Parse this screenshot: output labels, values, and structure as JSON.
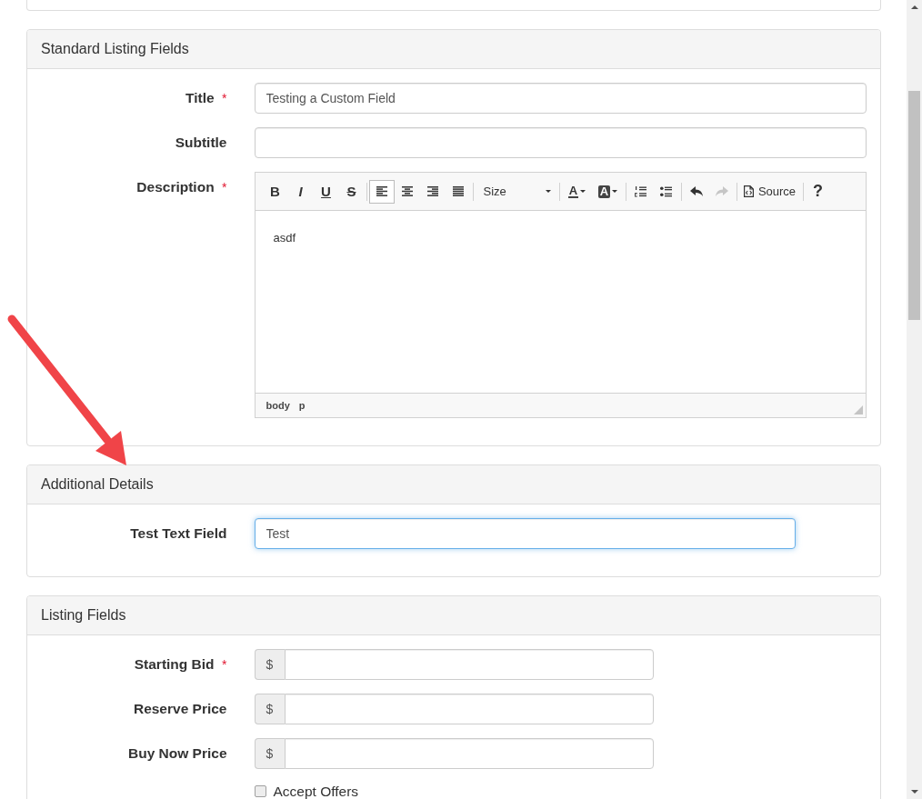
{
  "required_mark": "*",
  "panels": [
    {
      "title": "Standard Listing Fields",
      "fields": [
        {
          "kind": "text",
          "label": "Title",
          "required": true,
          "focused": false,
          "value": "Testing a Custom Field"
        },
        {
          "kind": "text",
          "label": "Subtitle",
          "required": false,
          "focused": false
        },
        {
          "kind": "editor",
          "label": "Description",
          "required": true,
          "toolbar": [
            [
              {
                "kind": "bold",
                "label": "B",
                "selected": false,
                "disabled": false
              },
              {
                "kind": "italic",
                "label": "I",
                "selected": false,
                "disabled": false
              },
              {
                "kind": "underline",
                "label": "U",
                "selected": false,
                "disabled": false
              },
              {
                "kind": "strike",
                "label": "S",
                "selected": false,
                "disabled": false
              }
            ],
            [
              {
                "kind": "alignleft",
                "selected": true,
                "disabled": false
              },
              {
                "kind": "aligncenter",
                "selected": false,
                "disabled": false
              },
              {
                "kind": "alignright",
                "selected": false,
                "disabled": false
              },
              {
                "kind": "justify",
                "selected": false,
                "disabled": false
              }
            ],
            [
              {
                "kind": "size",
                "label": "Size",
                "selected": false,
                "disabled": false
              }
            ],
            [
              {
                "kind": "textcolor",
                "label": "A",
                "selected": false,
                "disabled": false
              },
              {
                "kind": "bgcolor",
                "label": "A",
                "selected": false,
                "disabled": false
              }
            ],
            [
              {
                "kind": "numbered",
                "selected": false,
                "disabled": false
              },
              {
                "kind": "bulleted",
                "selected": false,
                "disabled": false
              }
            ],
            [
              {
                "kind": "undo",
                "selected": false,
                "disabled": false
              },
              {
                "kind": "redo",
                "selected": false,
                "disabled": true
              }
            ],
            [
              {
                "kind": "source",
                "label": "Source",
                "selected": false,
                "disabled": false
              }
            ],
            [
              {
                "kind": "help",
                "label": "?",
                "selected": false,
                "disabled": false
              }
            ]
          ],
          "content": "asdf",
          "element_path": [
            "body",
            "p"
          ]
        }
      ]
    },
    {
      "title": "Additional Details",
      "fields": [
        {
          "kind": "custom",
          "label": "Test Text Field",
          "required": false,
          "focused": true,
          "value": "Test"
        }
      ]
    },
    {
      "title": "Listing Fields",
      "fields": [
        {
          "kind": "money",
          "label": "Starting Bid",
          "required": true,
          "focused": false,
          "prefix": "$"
        },
        {
          "kind": "money",
          "label": "Reserve Price",
          "required": false,
          "focused": false,
          "prefix": "$"
        },
        {
          "kind": "money",
          "label": "Buy Now Price",
          "required": false,
          "focused": false,
          "prefix": "$"
        },
        {
          "kind": "checkbox",
          "label": "Accept Offers",
          "checked": false
        }
      ]
    }
  ]
}
